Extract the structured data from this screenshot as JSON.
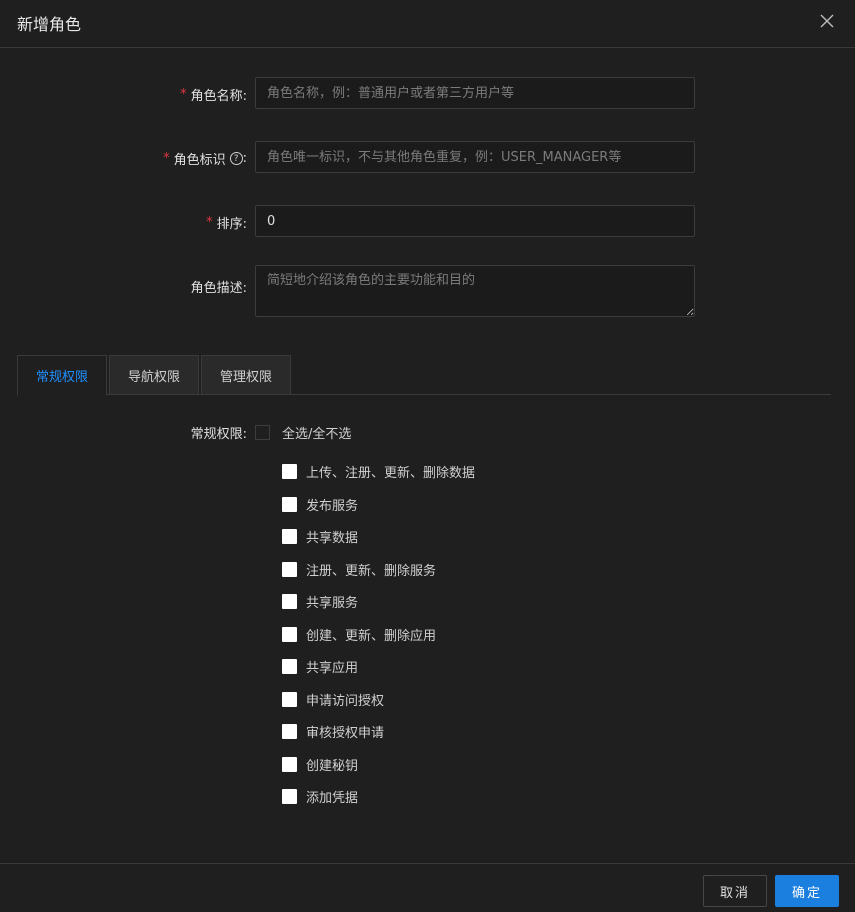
{
  "dialog": {
    "title": "新增角色"
  },
  "form": {
    "role_name": {
      "label": "角色名称:",
      "required": true,
      "value": "",
      "placeholder": "角色名称，例：普通用户或者第三方用户等"
    },
    "role_key": {
      "label": "角色标识",
      "colon": ":",
      "required": true,
      "help_icon": "question-circle-icon",
      "value": "",
      "placeholder": "角色唯一标识，不与其他角色重复，例：USER_MANAGER等"
    },
    "sort": {
      "label": "排序:",
      "required": true,
      "value": "0",
      "placeholder": ""
    },
    "description": {
      "label": "角色描述:",
      "required": false,
      "value": "",
      "placeholder": "简短地介绍该角色的主要功能和目的"
    }
  },
  "tabs": [
    {
      "label": "常规权限",
      "active": true
    },
    {
      "label": "导航权限",
      "active": false
    },
    {
      "label": "管理权限",
      "active": false
    }
  ],
  "permissions": {
    "label": "常规权限:",
    "select_all_label": "全选/全不选",
    "items": [
      {
        "label": "上传、注册、更新、删除数据",
        "checked": false
      },
      {
        "label": "发布服务",
        "checked": false
      },
      {
        "label": "共享数据",
        "checked": false
      },
      {
        "label": "注册、更新、删除服务",
        "checked": false
      },
      {
        "label": "共享服务",
        "checked": false
      },
      {
        "label": "创建、更新、删除应用",
        "checked": false
      },
      {
        "label": "共享应用",
        "checked": false
      },
      {
        "label": "申请访问授权",
        "checked": false
      },
      {
        "label": "审核授权申请",
        "checked": false
      },
      {
        "label": "创建秘钥",
        "checked": false
      },
      {
        "label": "添加凭据",
        "checked": false
      }
    ]
  },
  "footer": {
    "cancel_label": "取消",
    "ok_label": "确定"
  },
  "colors": {
    "background": "#1f1f1f",
    "accent": "#1a7fdf",
    "tab_active_text": "#1f8fff",
    "required_asterisk": "#e0383e"
  }
}
